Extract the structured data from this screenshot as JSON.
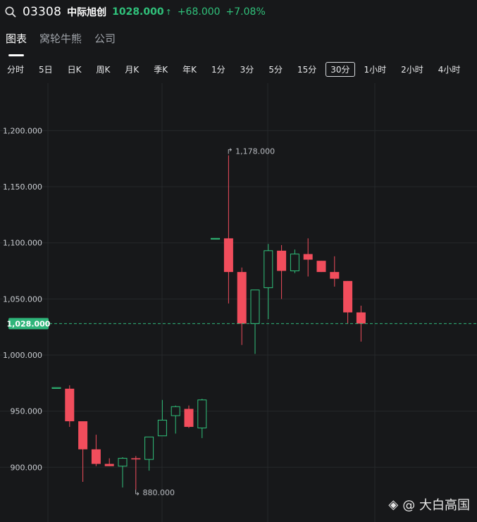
{
  "header": {
    "code": "03308",
    "name": "中际旭创",
    "price": "1028.000",
    "arrow": "↑",
    "change": "+68.000",
    "change_pct": "+7.08%"
  },
  "tabs": [
    {
      "label": "图表",
      "active": true
    },
    {
      "label": "窝轮牛熊",
      "active": false
    },
    {
      "label": "公司",
      "active": false
    }
  ],
  "periods": [
    {
      "label": "分时"
    },
    {
      "label": "5日"
    },
    {
      "label": "日K"
    },
    {
      "label": "周K"
    },
    {
      "label": "月K"
    },
    {
      "label": "季K"
    },
    {
      "label": "年K"
    },
    {
      "label": "1分"
    },
    {
      "label": "3分"
    },
    {
      "label": "5分"
    },
    {
      "label": "15分"
    },
    {
      "label": "30分",
      "active": true
    },
    {
      "label": "1小时"
    },
    {
      "label": "2小时"
    },
    {
      "label": "4小时"
    }
  ],
  "colors": {
    "up": "#f14d5c",
    "down": "#30c07a",
    "flat": "#30c07a",
    "grid": "#26282b",
    "last_price_line": "#2fb57a"
  },
  "watermark": {
    "logo_icon": "◈",
    "text": "@ 大白高国"
  },
  "chart_data": {
    "type": "candlestick",
    "ylim": [
      885,
      1218
    ],
    "yticks": [
      {
        "value": 900,
        "label": "900.000"
      },
      {
        "value": 950,
        "label": "950.000"
      },
      {
        "value": 1000,
        "label": "1,000.000"
      },
      {
        "value": 1050,
        "label": "1,050.000"
      },
      {
        "value": 1100,
        "label": "1,100.000"
      },
      {
        "value": 1150,
        "label": "1,150.000"
      },
      {
        "value": 1200,
        "label": "1,200.000"
      }
    ],
    "last_price": {
      "value": 1028,
      "label": "1,028.000"
    },
    "annotations": [
      {
        "candle": 13,
        "value": 1178,
        "label": "1,178.000"
      },
      {
        "candle": 6,
        "value": 880,
        "label": "880.000"
      }
    ],
    "candles": [
      {
        "o": 971,
        "h": 971,
        "l": 971,
        "c": 971
      },
      {
        "o": 970,
        "h": 973,
        "l": 936,
        "c": 941
      },
      {
        "o": 941,
        "h": 941,
        "l": 887,
        "c": 916
      },
      {
        "o": 916,
        "h": 929,
        "l": 901,
        "c": 903
      },
      {
        "o": 903,
        "h": 908,
        "l": 901,
        "c": 901
      },
      {
        "o": 901,
        "h": 909,
        "l": 882,
        "c": 908
      },
      {
        "o": 908,
        "h": 910,
        "l": 880,
        "c": 907
      },
      {
        "o": 907,
        "h": 927,
        "l": 897,
        "c": 927
      },
      {
        "o": 928,
        "h": 960,
        "l": 928,
        "c": 942
      },
      {
        "o": 946,
        "h": 955,
        "l": 930,
        "c": 954
      },
      {
        "o": 952,
        "h": 955,
        "l": 935,
        "c": 936
      },
      {
        "o": 935,
        "h": 961,
        "l": 926,
        "c": 960
      },
      {
        "o": 1104,
        "h": 1104,
        "l": 1104,
        "c": 1104
      },
      {
        "o": 1104,
        "h": 1178,
        "l": 1046,
        "c": 1074
      },
      {
        "o": 1074,
        "h": 1078,
        "l": 1009,
        "c": 1028
      },
      {
        "o": 1028,
        "h": 1058,
        "l": 1001,
        "c": 1058
      },
      {
        "o": 1060,
        "h": 1099,
        "l": 1032,
        "c": 1093
      },
      {
        "o": 1093,
        "h": 1098,
        "l": 1050,
        "c": 1075
      },
      {
        "o": 1075,
        "h": 1094,
        "l": 1073,
        "c": 1090
      },
      {
        "o": 1090,
        "h": 1104,
        "l": 1070,
        "c": 1085
      },
      {
        "o": 1084,
        "h": 1084,
        "l": 1074,
        "c": 1074
      },
      {
        "o": 1074,
        "h": 1088,
        "l": 1061,
        "c": 1068
      },
      {
        "o": 1066,
        "h": 1066,
        "l": 1028,
        "c": 1038
      },
      {
        "o": 1038,
        "h": 1044,
        "l": 1012,
        "c": 1028
      }
    ]
  }
}
